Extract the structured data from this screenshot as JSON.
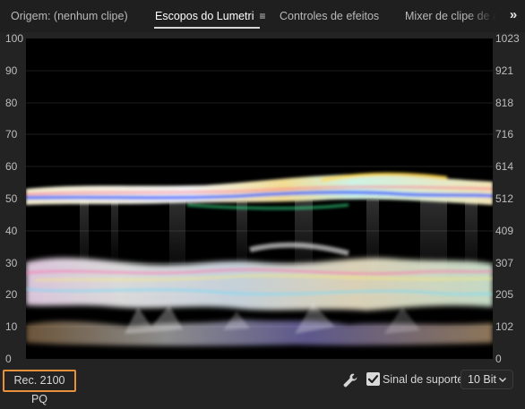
{
  "tabs": [
    {
      "label": "Origem: (nenhum clipe)",
      "active": false
    },
    {
      "label": "Escopos do Lumetri",
      "active": true,
      "menu_icon": "hamburger-menu-icon",
      "menu_glyph": "≡"
    },
    {
      "label": "Controles de efeitos",
      "active": false
    },
    {
      "label": "Mixer de clipe de á",
      "active": false
    }
  ],
  "overflow": {
    "icon": "double-chevron-right-icon",
    "glyph": "»"
  },
  "scope": {
    "type": "waveform",
    "left_axis": [
      "100",
      "90",
      "80",
      "70",
      "60",
      "50",
      "40",
      "30",
      "20",
      "10",
      "0"
    ],
    "right_axis": [
      "1023",
      "921",
      "818",
      "716",
      "614",
      "512",
      "409",
      "307",
      "205",
      "102",
      "0"
    ]
  },
  "bottom": {
    "color_space": "Rec. 2100 PQ",
    "settings_icon": "wrench-icon",
    "support_signal": {
      "label": "Sinal de suporte",
      "checked": true
    },
    "bit_depth": {
      "value": "10 Bit",
      "icon": "chevron-down-icon"
    }
  },
  "colors": {
    "panel_bg": "#232323",
    "tab_bg": "#1f1f1f",
    "highlight": "#e8903a",
    "scope_bg": "#000000"
  }
}
